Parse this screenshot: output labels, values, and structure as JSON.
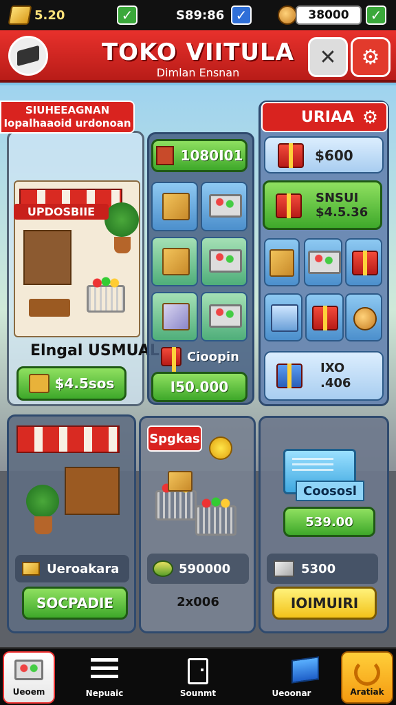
{
  "status_bar": {
    "gold_value": "5.20",
    "middle_value": "S89:86",
    "coins_value": "38000"
  },
  "header": {
    "title": "TOKO VIITULA",
    "subtitle": "Dimlan Ensnan"
  },
  "left_panel": {
    "banner_line1": "SIUHEEAGNAN",
    "banner_line2": "Iopalhaaoid urdonoan",
    "shop_sign": "UPDOSBIIE",
    "name": "Elngal USMUAL",
    "price_button": "$4.5sos"
  },
  "middle_panel": {
    "top_button": "1080I01",
    "item_label": "Cioopin",
    "bottom_button": "I50.000"
  },
  "right_panel": {
    "header": "URIAA",
    "row1_value": "$600",
    "row2_line1": "SNSUI",
    "row2_line2": "$4.5.36",
    "row4_line1": "IXO",
    "row4_line2": ".406"
  },
  "bottom_left": {
    "label": "Ueroakara",
    "button": "SOCPADIE"
  },
  "bottom_middle": {
    "tag": "Spgkas",
    "value": "590000",
    "sub_value": "2x006"
  },
  "bottom_right": {
    "card_label": "Coososl",
    "price_button": "539.00",
    "value": "5300",
    "yellow_button": "IOIMUIRI"
  },
  "bottom_nav": [
    {
      "label": "Ueoem"
    },
    {
      "label": "Nepuaic"
    },
    {
      "label": "Sounmt"
    },
    {
      "label": "Ueoonar"
    },
    {
      "label": "Aratiak"
    }
  ],
  "colors": {
    "header_red": "#e8312c",
    "button_green": "#3ea82a",
    "button_yellow": "#f2c21a",
    "panel_blue": "#2f4a6e"
  }
}
